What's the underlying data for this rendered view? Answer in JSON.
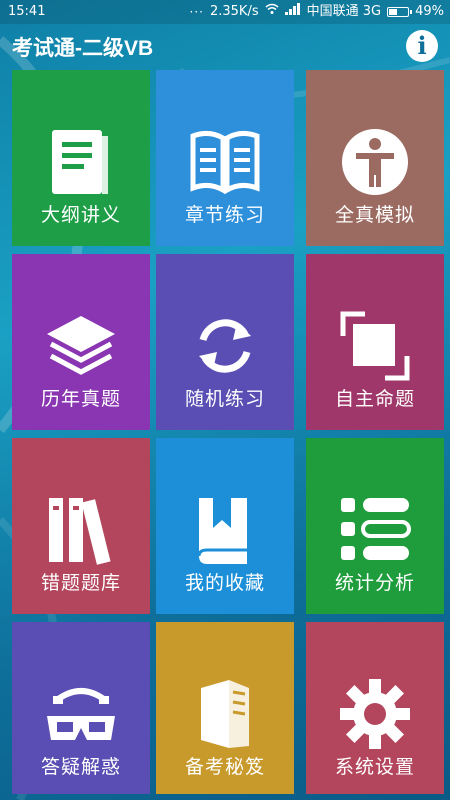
{
  "status_bar": {
    "time": "15:41",
    "dots": "···",
    "speed": "2.35K/s",
    "carrier": "中国联通 3G",
    "battery_percent": "49%",
    "battery_level": 0.49
  },
  "app": {
    "title": "考试通-二级VB",
    "info_icon": "i"
  },
  "tiles": [
    {
      "label": "大纲讲义",
      "icon": "notebook-icon",
      "color": "#1e9f47"
    },
    {
      "label": "章节练习",
      "icon": "open-book-icon",
      "color": "#2e8fdb"
    },
    {
      "label": "全真模拟",
      "icon": "person-circle-icon",
      "color": "#9b6b62"
    },
    {
      "label": "历年真题",
      "icon": "layers-icon",
      "color": "#8a35b1"
    },
    {
      "label": "随机练习",
      "icon": "refresh-icon",
      "color": "#5a4db3"
    },
    {
      "label": "自主命题",
      "icon": "crop-square-icon",
      "color": "#a0376a"
    },
    {
      "label": "错题题库",
      "icon": "binders-icon",
      "color": "#b3465d"
    },
    {
      "label": "我的收藏",
      "icon": "bookmark-book-icon",
      "color": "#1c8fd8"
    },
    {
      "label": "统计分析",
      "icon": "list-icon",
      "color": "#1f9c3c"
    },
    {
      "label": "答疑解惑",
      "icon": "glasses-phone-icon",
      "color": "#5a4db3"
    },
    {
      "label": "备考秘笈",
      "icon": "open-folio-icon",
      "color": "#c8992b"
    },
    {
      "label": "系统设置",
      "icon": "gear-icon",
      "color": "#b3465d"
    }
  ]
}
